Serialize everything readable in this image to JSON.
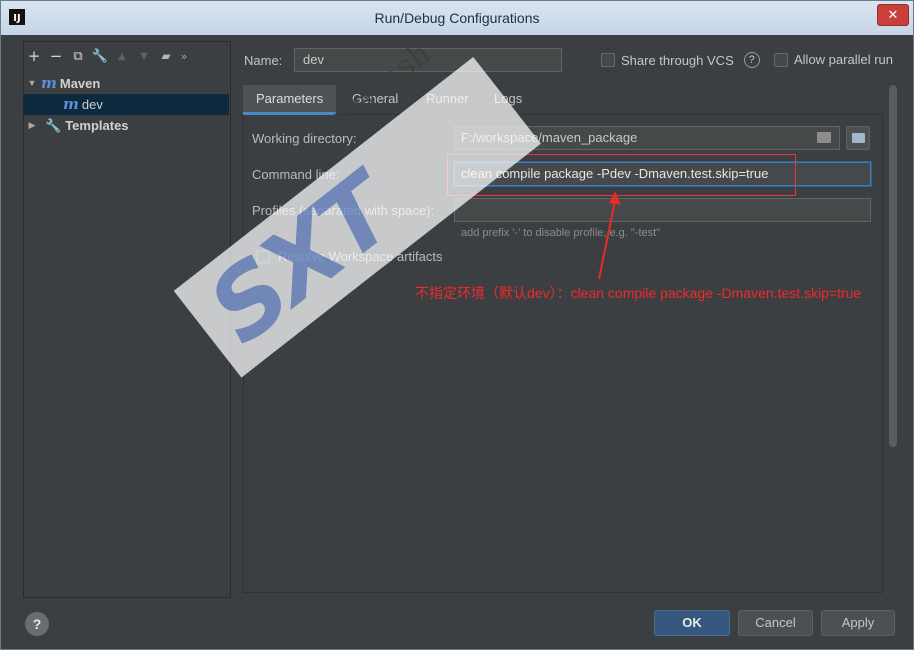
{
  "window": {
    "title": "Run/Debug Configurations",
    "close_glyph": "✕",
    "app_icon_text": "IJ"
  },
  "toolbar": {
    "buttons": [
      {
        "name": "add-icon",
        "glyph": "+"
      },
      {
        "name": "remove-icon",
        "glyph": "−"
      },
      {
        "name": "copy-icon",
        "glyph": "⧉"
      },
      {
        "name": "wrench-icon",
        "glyph": "🔧"
      },
      {
        "name": "move-up-icon",
        "glyph": "▲"
      },
      {
        "name": "move-down-icon",
        "glyph": "▼"
      },
      {
        "name": "folder-icon",
        "glyph": "▰"
      },
      {
        "name": "more-icon",
        "glyph": "»"
      }
    ]
  },
  "tree": {
    "maven_label": "Maven",
    "maven_icon": "m",
    "dev_label": "dev",
    "dev_icon": "m",
    "templates_label": "Templates"
  },
  "config": {
    "name_label": "Name:",
    "name_value": "dev",
    "share_label": "Share through VCS",
    "help_glyph": "?",
    "parallel_label": "Allow parallel run"
  },
  "tabs": [
    "Parameters",
    "General",
    "Runner",
    "Logs"
  ],
  "fields": {
    "working_dir_label": "Working directory:",
    "working_dir_value": "F:/workspace/maven_package",
    "command_line_label": "Command line:",
    "command_line_value": "clean compile package -Pdev -Dmaven.test.skip=true",
    "profiles_label": "Profiles (separated with space):",
    "profiles_value": "",
    "profiles_hint": "add prefix '-' to disable profile, e.g. \"-test\"",
    "resolve_label": "Resolve Workspace artifacts"
  },
  "annotation": {
    "text": "不指定环境（默认dev）：clean compile package  -Dmaven.test.skip=true",
    "color": "#f02a2a"
  },
  "footer": {
    "help_glyph": "?",
    "ok_label": "OK",
    "cancel_label": "Cancel",
    "apply_label": "Apply"
  },
  "watermark": {
    "text": "SXT",
    "url": "www.sh"
  }
}
